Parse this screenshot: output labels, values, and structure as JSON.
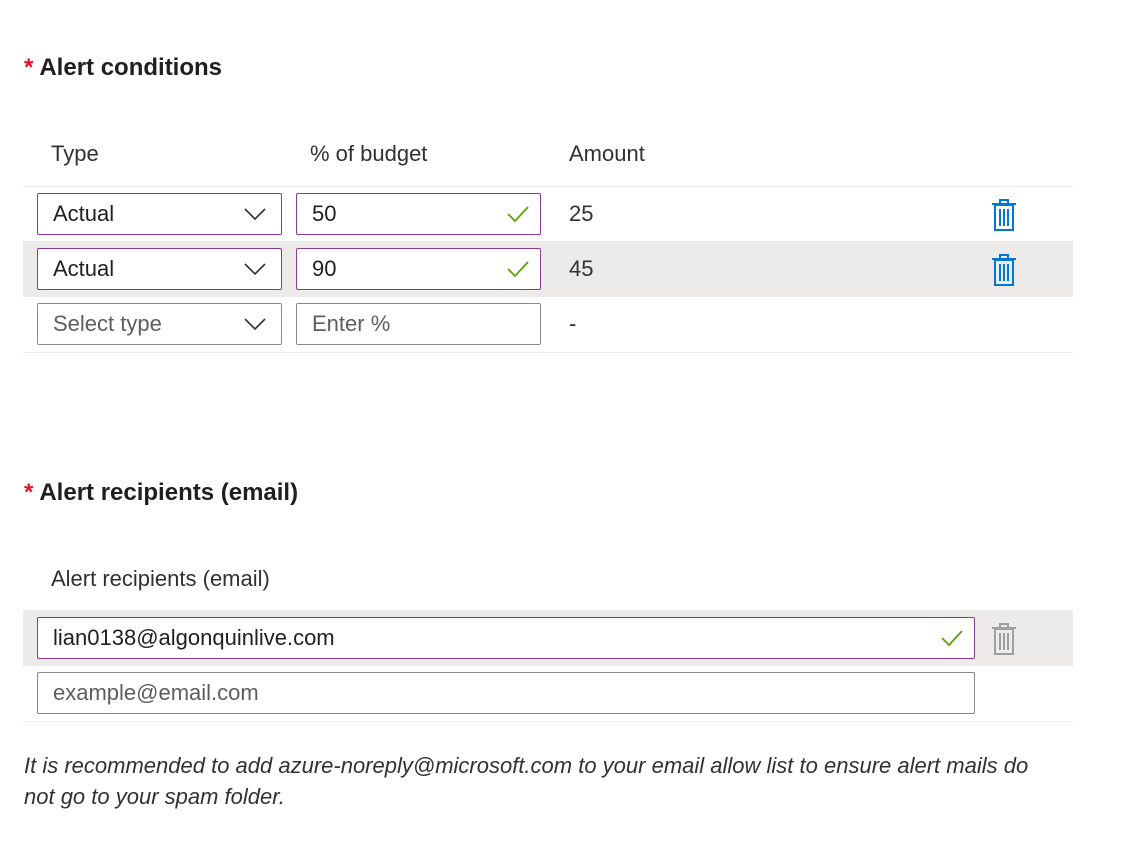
{
  "alert_conditions": {
    "required_marker": "*",
    "title": "Alert conditions",
    "columns": {
      "type": "Type",
      "percent": "% of budget",
      "amount": "Amount"
    },
    "rows": [
      {
        "type": "Actual",
        "percent": "50",
        "amount": "25",
        "valid": true
      },
      {
        "type": "Actual",
        "percent": "90",
        "amount": "45",
        "valid": true
      },
      {
        "type_placeholder": "Select type",
        "percent_placeholder": "Enter %",
        "amount": "-"
      }
    ]
  },
  "alert_recipients": {
    "required_marker": "*",
    "title": "Alert recipients (email)",
    "column_header": "Alert recipients (email)",
    "rows": [
      {
        "email": "lian0138@algonquinlive.com",
        "valid": true
      },
      {
        "placeholder": "example@email.com"
      }
    ]
  },
  "note": "It is recommended to add azure-noreply@microsoft.com to your email allow list to ensure alert mails do not go to your spam folder.",
  "colors": {
    "required": "#e81123",
    "valid_border": "#8a3b9a",
    "check": "#57a300",
    "trash_active": "#0078d4",
    "trash_disabled": "#a19f9d",
    "selected_row": "#edebe9"
  }
}
